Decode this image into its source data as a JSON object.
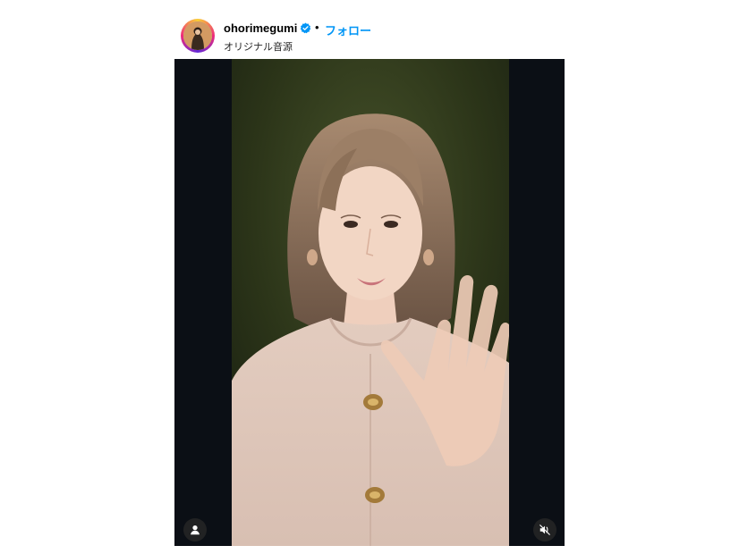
{
  "post": {
    "username": "ohorimegumi",
    "verified": true,
    "separator": "•",
    "follow_label": "フォロー",
    "audio_label": "オリジナル音源"
  },
  "video": {
    "controls": {
      "user_tags_icon": "person-icon",
      "mute_icon": "speaker-muted-icon"
    }
  },
  "colors": {
    "accent": "#0095f6",
    "verified_badge": "#0095f6",
    "video_background": "#0b0f15"
  }
}
